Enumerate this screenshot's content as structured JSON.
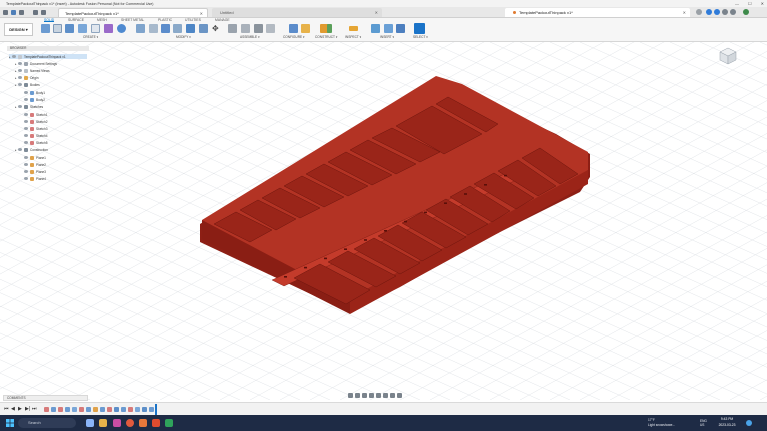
{
  "window": {
    "title": "TemplatePackoutThinpack v1* (Insert) - Autodesk Fusion Personal (Not for Commercial Use)",
    "controls": [
      "—",
      "☐",
      "✕"
    ]
  },
  "appbar": {
    "doc_tab": "TemplatePackoutThinpack v1*",
    "doc_tab2": "Untitled",
    "doc_tab3": "TemplatePackoutThinpack v1*"
  },
  "ribbon": {
    "workspace": "DESIGN ▾",
    "tabs": [
      "SOLID",
      "SURFACE",
      "MESH",
      "SHEET METAL",
      "PLASTIC",
      "UTILITIES",
      "MANAGE"
    ],
    "groups": [
      "CREATE ▾",
      "MODIFY ▾",
      "ASSEMBLE ▾",
      "CONFIGURE ▾",
      "CONSTRUCT ▾",
      "INSPECT ▾",
      "INSERT ▾",
      "SELECT ▾"
    ]
  },
  "browser": {
    "header": "BROWSER",
    "nodes": [
      {
        "label": "TemplatePackoutThinpack v1",
        "level": 0,
        "selected": true
      },
      {
        "label": "Document Settings",
        "level": 1
      },
      {
        "label": "Named Views",
        "level": 1
      },
      {
        "label": "Origin",
        "level": 1
      },
      {
        "label": "Bodies",
        "level": 1
      },
      {
        "label": "Body1",
        "level": 2
      },
      {
        "label": "Body2",
        "level": 2
      },
      {
        "label": "Sketches",
        "level": 1
      },
      {
        "label": "Sketch1",
        "level": 2
      },
      {
        "label": "Sketch2",
        "level": 2
      },
      {
        "label": "Sketch3",
        "level": 2
      },
      {
        "label": "Sketch4",
        "level": 2
      },
      {
        "label": "Sketch5",
        "level": 2
      },
      {
        "label": "Construction",
        "level": 1
      },
      {
        "label": "Plane1",
        "level": 2
      },
      {
        "label": "Plane2",
        "level": 2
      },
      {
        "label": "Plane3",
        "level": 2
      },
      {
        "label": "Plane4",
        "level": 2
      }
    ]
  },
  "comments": {
    "label": "COMMENTS"
  },
  "timeline": {
    "buttons": [
      "⏮",
      "◀",
      "▶",
      "▶|",
      "⏭"
    ]
  },
  "taskbar": {
    "search": "Search",
    "weather_temp": "17°F",
    "weather_desc": "Light snowshowe...",
    "lang": "ENG",
    "region": "US",
    "time": "9:43 PM",
    "date": "2023-03-23"
  },
  "colors": {
    "model": "#a8271c",
    "accent": "#0a76c9"
  }
}
